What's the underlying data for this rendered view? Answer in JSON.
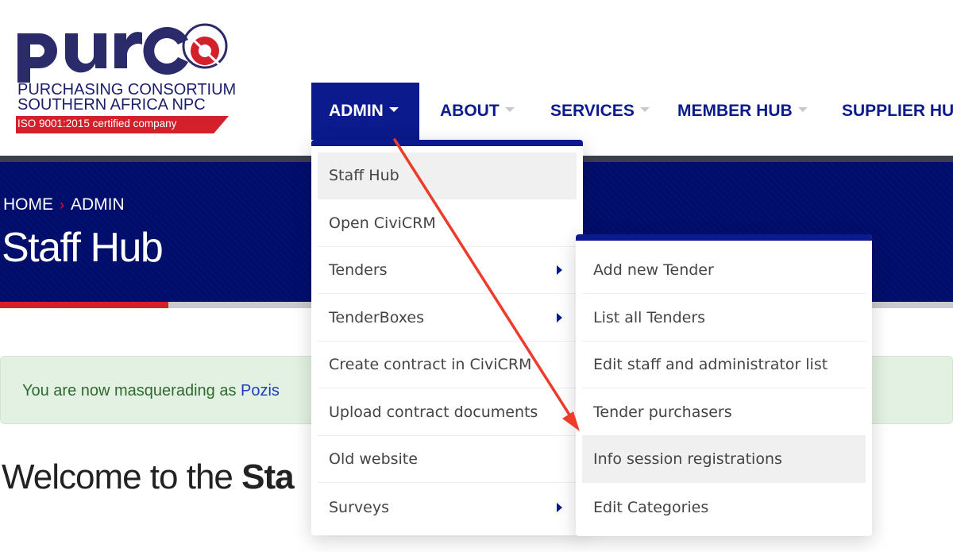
{
  "logo": {
    "wordmark": "purco",
    "line1": "PURCHASING CONSORTIUM",
    "line2": "SOUTHERN AFRICA NPC",
    "iso": "ISO 9001:2015 certified company",
    "brand_navy": "#2b2a6b",
    "brand_red": "#d3202a"
  },
  "nav": {
    "items": [
      {
        "label": "ADMIN",
        "active": true
      },
      {
        "label": "ABOUT"
      },
      {
        "label": "SERVICES"
      },
      {
        "label": "MEMBER HUB"
      },
      {
        "label": "SUPPLIER HUB"
      }
    ]
  },
  "hero": {
    "breadcrumb": [
      "HOME",
      "ADMIN"
    ],
    "breadcrumb_separator": "›",
    "title": "Staff Hub"
  },
  "alert": {
    "text": "You are now masquerading as ",
    "link": "Pozis"
  },
  "welcome": {
    "prefix": "Welcome to the ",
    "bold": "Sta"
  },
  "admin_menu": {
    "items": [
      {
        "label": "Staff Hub",
        "hover": true
      },
      {
        "label": "Open CiviCRM"
      },
      {
        "label": "Tenders",
        "submenu": true
      },
      {
        "label": "TenderBoxes",
        "submenu": true
      },
      {
        "label": "Create contract in CiviCRM"
      },
      {
        "label": "Upload contract documents"
      },
      {
        "label": "Old website"
      },
      {
        "label": "Surveys",
        "submenu": true
      }
    ]
  },
  "tenders_submenu": {
    "items": [
      {
        "label": "Add new Tender"
      },
      {
        "label": "List all Tenders"
      },
      {
        "label": "Edit staff and administrator list"
      },
      {
        "label": "Tender purchasers"
      },
      {
        "label": "Info session registrations",
        "hover": true
      },
      {
        "label": "Edit Categories"
      }
    ]
  },
  "colors": {
    "nav_blue": "#0b1a8c",
    "hero_bg": "#000d6b",
    "accent_red": "#d3202a",
    "alert_bg": "#e3f1e2",
    "annotation_arrow": "#ee3b2a"
  }
}
